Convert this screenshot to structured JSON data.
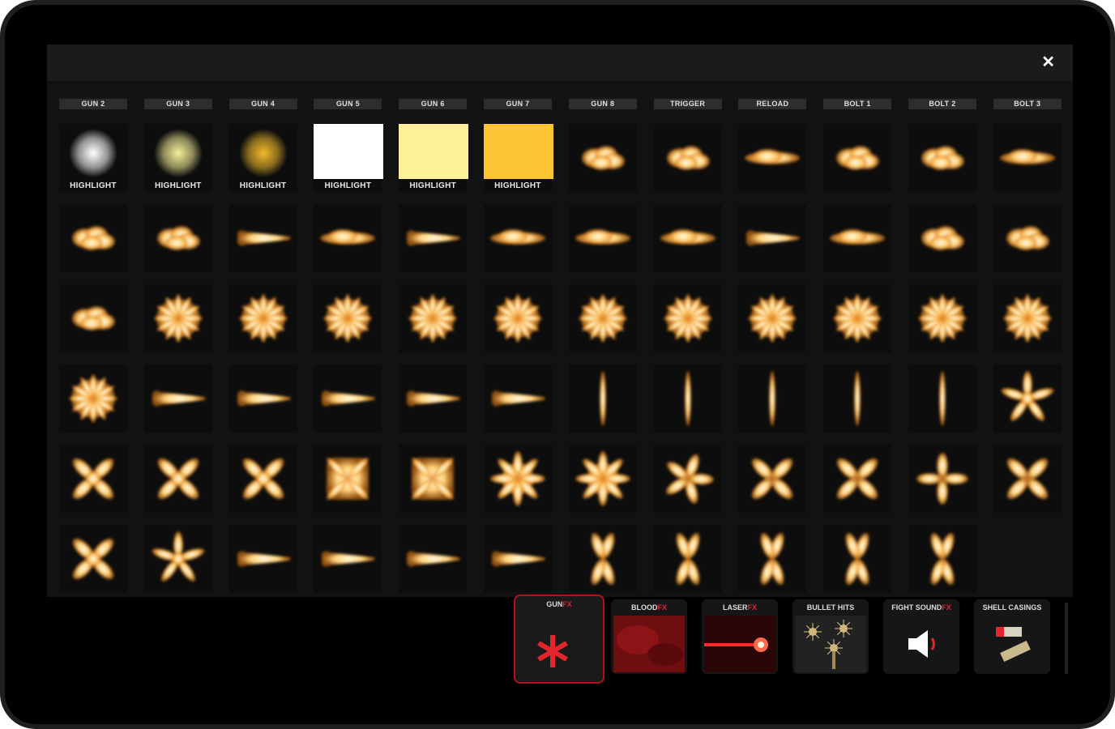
{
  "window": {
    "close_glyph": "✕"
  },
  "columns": [
    "GUN 2",
    "GUN 3",
    "GUN 4",
    "GUN 5",
    "GUN 6",
    "GUN 7",
    "GUN 8",
    "TRIGGER",
    "RELOAD",
    "BOLT 1",
    "BOLT 2",
    "BOLT 3"
  ],
  "highlights": [
    {
      "label": "HIGHLIGHT",
      "kind": "glow",
      "color": "#ffffff"
    },
    {
      "label": "HIGHLIGHT",
      "kind": "glow",
      "color": "#f5ee9a"
    },
    {
      "label": "HIGHLIGHT",
      "kind": "glow",
      "color": "#f1b92c"
    },
    {
      "label": "HIGHLIGHT",
      "kind": "solid",
      "color": "#ffffff"
    },
    {
      "label": "HIGHLIGHT",
      "kind": "solid",
      "color": "#fff09a"
    },
    {
      "label": "HIGHLIGHT",
      "kind": "solid",
      "color": "#fcc534"
    }
  ],
  "flash_grid": [
    [
      "",
      "",
      "",
      "",
      "",
      "",
      "cloud",
      "cloud",
      "streak",
      "cloud",
      "cloud",
      "streak"
    ],
    [
      "cloud",
      "cloud",
      "cone",
      "streak",
      "cone",
      "streak",
      "streak",
      "streak",
      "cone",
      "streak",
      "cloud",
      "cloud"
    ],
    [
      "cloud",
      "burst",
      "burst",
      "burst",
      "burst",
      "burst",
      "burst",
      "burst",
      "burst",
      "burst",
      "burst",
      "burst"
    ],
    [
      "burst",
      "cone",
      "cone",
      "cone",
      "cone",
      "cone",
      "bar",
      "bar",
      "bar",
      "bar",
      "bar",
      "star5"
    ],
    [
      "x4",
      "x4",
      "x4",
      "square",
      "square",
      "star8",
      "star8",
      "petal5",
      "petal4",
      "petal4",
      "cross4",
      "petal4"
    ],
    [
      "x4",
      "star5",
      "cone",
      "cone",
      "cone",
      "cone",
      "petalx",
      "petalx",
      "petalx",
      "petalx",
      "petalx",
      ""
    ]
  ],
  "categories": [
    {
      "label": "GUN",
      "fx": "FX",
      "icon": "asterisk-icon",
      "active": true
    },
    {
      "label": "BLOOD",
      "fx": "FX",
      "icon": "blood-icon",
      "active": false
    },
    {
      "label": "LASER",
      "fx": "FX",
      "icon": "laser-icon",
      "active": false
    },
    {
      "label": "BULLET HITS",
      "fx": "",
      "icon": "bullet-hits-icon",
      "active": false
    },
    {
      "label": "FIGHT SOUND",
      "fx": "FX",
      "icon": "speaker-icon",
      "active": false
    },
    {
      "label": "SHELL CASINGS",
      "fx": "",
      "icon": "shell-casings-icon",
      "active": false
    }
  ],
  "colors": {
    "flash_core": "#fffbe6",
    "flash_mid": "#ffd27a",
    "flash_outer": "#e07a10",
    "accent": "#e3262c"
  }
}
